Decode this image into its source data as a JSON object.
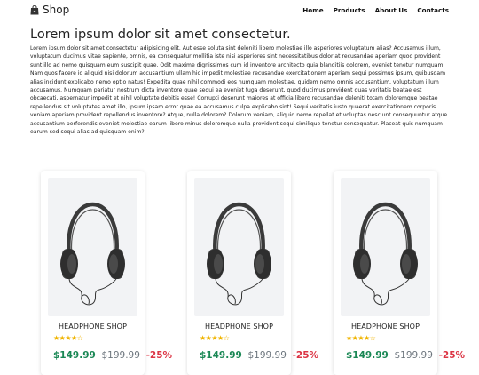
{
  "navbar": {
    "brand": "Shop",
    "links": [
      "Home",
      "Products",
      "About Us",
      "Contacts"
    ]
  },
  "intro": {
    "title": "Lorem ipsum dolor sit amet consectetur.",
    "body": "Lorem ipsum dolor sit amet consectetur adipisicing elit. Aut esse soluta sint deleniti libero molestiae illo asperiores voluptatum alias? Accusamus illum, voluptatum ducimus vitae sapiente, omnis, ea consequatur mollitia iste nisi asperiores sint necessitatibus dolor at recusandae aperiam quod provident sunt illo ad nemo quisquam eum suscipit quae. Odit maxime dignissimos cum id inventore architecto quia blanditiis dolorem, eveniet tenetur numquam. Nam quos facere id aliquid nisi dolorum accusantium ullam hic impedit molestiae recusandae exercitationem aperiam sequi possimus ipsum, quibusdam alias incidunt explicabo nemo optio natus! Expedita quae nihil commodi eos numquam molestiae, quidem nemo omnis accusantium, voluptatum illum accusamus. Numquam pariatur nostrum dicta inventore quae sequi ea eveniet fuga deserunt, quod ducimus provident quas veritatis beatae est obcaecati, aspernatur impedit et nihil voluptate debitis esse! Corrupti deserunt maiores at officia libero recusandae deleniti totam doloremque beatae repellendus sit voluptates amet illo, ipsum ipsam error quae ea accusamus culpa explicabo sint! Sequi veritatis iusto quaerat exercitationem corporis veniam aperiam provident repellendus inventore? Atque, nulla dolorem? Dolorum veniam, aliquid nemo repellat et voluptas nesciunt consequuntur atque accusantium perferendis eveniet molestiae earum libero minus doloremque nulla provident sequi similique tenetur consequatur. Placeat quis numquam earum sed sequi alias ad quisquam enim?"
  },
  "products": [
    {
      "title": "HEADPHONE SHOP",
      "rating": 4,
      "rating_max": 5,
      "price": "$149.99",
      "old_price": "$199.99",
      "discount": "-25%"
    },
    {
      "title": "HEADPHONE SHOP",
      "rating": 4,
      "rating_max": 5,
      "price": "$149.99",
      "old_price": "$199.99",
      "discount": "-25%"
    },
    {
      "title": "HEADPHONE SHOP",
      "rating": 4,
      "rating_max": 5,
      "price": "$149.99",
      "old_price": "$199.99",
      "discount": "-25%"
    }
  ],
  "icons": {
    "brand": "shopping-bag-icon",
    "product_image": "headphones-icon",
    "rating": "star-icon"
  },
  "colors": {
    "price": "#198754",
    "discount": "#dc3545",
    "stars": "#f0b400"
  }
}
